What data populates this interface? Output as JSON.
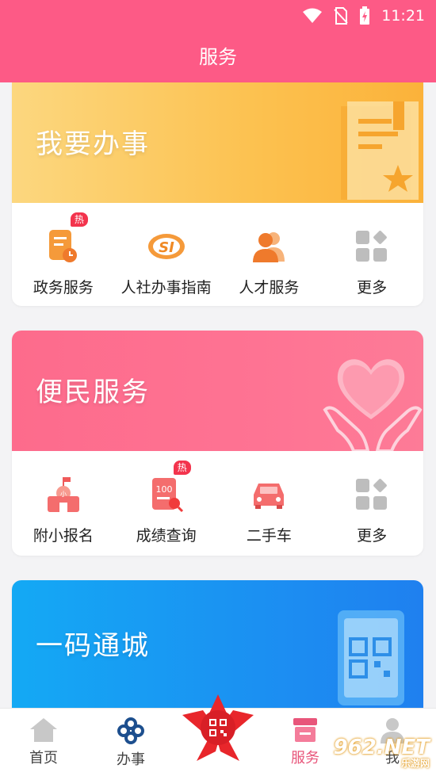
{
  "status_bar": {
    "time": "11:21"
  },
  "header": {
    "title": "服务"
  },
  "sections": [
    {
      "title": "我要办事",
      "items": [
        {
          "label": "政务服务",
          "icon": "document-clock-icon",
          "badge": "热"
        },
        {
          "label": "人社办事指南",
          "icon": "si-logo-icon",
          "badge": ""
        },
        {
          "label": "人才服务",
          "icon": "people-icon",
          "badge": ""
        },
        {
          "label": "更多",
          "icon": "grid-more-icon",
          "badge": ""
        }
      ]
    },
    {
      "title": "便民服务",
      "items": [
        {
          "label": "附小报名",
          "icon": "school-icon",
          "badge": ""
        },
        {
          "label": "成绩查询",
          "icon": "score-search-icon",
          "badge": "热"
        },
        {
          "label": "二手车",
          "icon": "car-icon",
          "badge": ""
        },
        {
          "label": "更多",
          "icon": "grid-more-icon",
          "badge": ""
        }
      ]
    },
    {
      "title": "一码通城",
      "items": []
    }
  ],
  "bottom_nav": {
    "items": [
      {
        "label": "首页",
        "icon": "home-icon",
        "active": false
      },
      {
        "label": "办事",
        "icon": "knot-icon",
        "active": false
      },
      {
        "label": "",
        "icon": "qr-flower-icon",
        "active": false
      },
      {
        "label": "服务",
        "icon": "store-icon",
        "active": true
      },
      {
        "label": "我",
        "icon": "user-icon",
        "active": false
      }
    ]
  },
  "watermark": {
    "text": "962.NET",
    "sub": "乐游网"
  },
  "colors": {
    "header": "#fd5a86",
    "active_nav": "#e8557a",
    "hot_badge": "#f3344d"
  }
}
